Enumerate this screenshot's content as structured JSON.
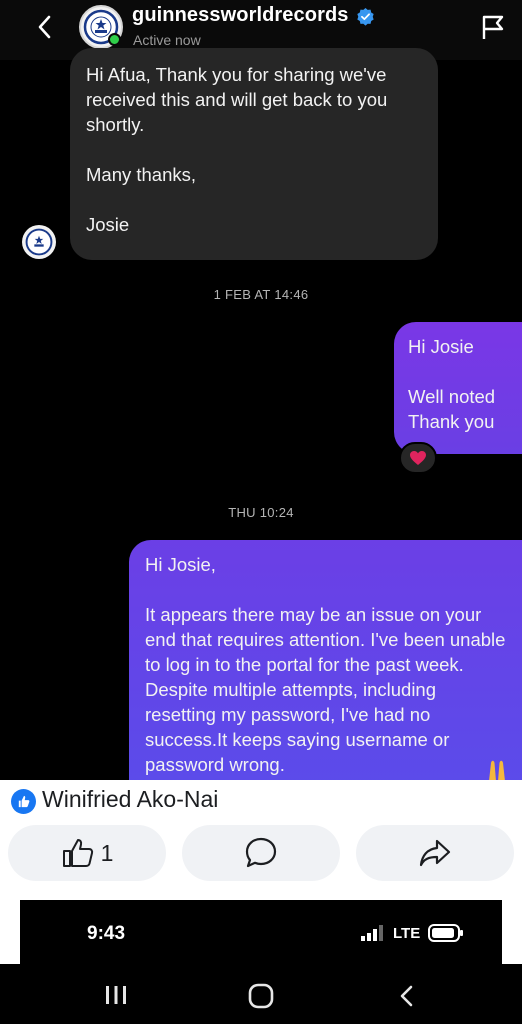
{
  "header": {
    "username": "guinnessworldrecords",
    "status": "Active now",
    "icons": [
      "back-icon",
      "guinness-logo",
      "verified-badge-icon",
      "flag-icon"
    ]
  },
  "messages": {
    "incoming_1": {
      "line1": "Hi Afua, Thank you for sharing we've received this and will get back to you shortly.",
      "line2": "Many thanks,",
      "line3": "Josie"
    },
    "timestamp_1": "1 FEB AT 14:46",
    "outgoing_1": {
      "line1": "Hi Josie",
      "line2": "Well noted Thank you",
      "reaction": "heart-reaction-icon"
    },
    "timestamp_2": "THU 10:24",
    "outgoing_2": {
      "line1": "Hi Josie,",
      "line2": "It appears there may be an issue on your end that requires attention. I've been unable to log in to the portal for the past week. Despite multiple attempts, including resetting my password, I've had no success.It keeps saying username or password wrong."
    }
  },
  "facebook": {
    "author": "Winifried Ako-Nai",
    "like_count": "1",
    "icons": [
      "like-icon",
      "comment-icon",
      "share-icon"
    ]
  },
  "phone": {
    "time": "9:43",
    "network": "LTE"
  },
  "colors": {
    "incoming_bubble": "#262626",
    "outgoing_bubble": "#6b3fe6",
    "fb_blue": "#1877f2",
    "online_green": "#2fcf4a"
  }
}
